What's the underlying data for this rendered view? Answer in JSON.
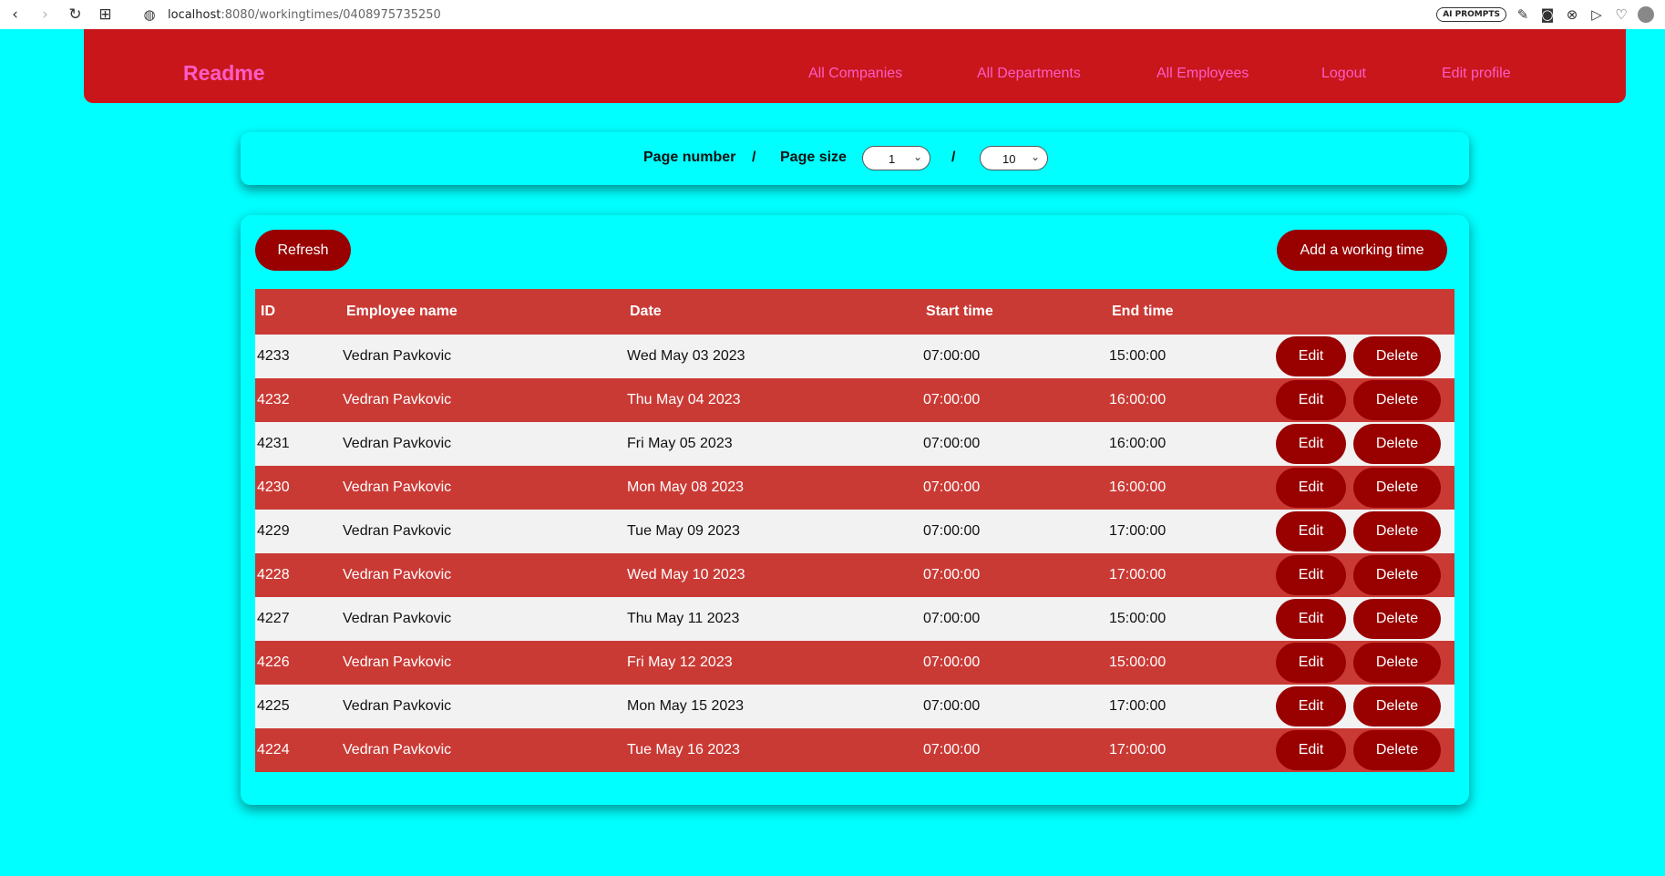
{
  "browser": {
    "url_host": "localhost",
    "url_rest": ":8080/workingtimes/0408975735250",
    "ai_prompts_label": "AI PROMPTS"
  },
  "header": {
    "brand": "Readme",
    "nav": [
      "All Companies",
      "All Departments",
      "All Employees",
      "Logout",
      "Edit profile"
    ]
  },
  "pagination": {
    "page_number_label": "Page number",
    "separator": "/",
    "page_size_label": "Page size",
    "page_number_value": "1",
    "page_size_value": "10"
  },
  "toolbar": {
    "refresh_label": "Refresh",
    "add_label": "Add a working time"
  },
  "table": {
    "columns": [
      "ID",
      "Employee name",
      "Date",
      "Start time",
      "End time"
    ],
    "edit_label": "Edit",
    "delete_label": "Delete",
    "rows": [
      {
        "id": "4233",
        "name": "Vedran Pavkovic",
        "date": "Wed May 03 2023",
        "start": "07:00:00",
        "end": "15:00:00"
      },
      {
        "id": "4232",
        "name": "Vedran Pavkovic",
        "date": "Thu May 04 2023",
        "start": "07:00:00",
        "end": "16:00:00"
      },
      {
        "id": "4231",
        "name": "Vedran Pavkovic",
        "date": "Fri May 05 2023",
        "start": "07:00:00",
        "end": "16:00:00"
      },
      {
        "id": "4230",
        "name": "Vedran Pavkovic",
        "date": "Mon May 08 2023",
        "start": "07:00:00",
        "end": "16:00:00"
      },
      {
        "id": "4229",
        "name": "Vedran Pavkovic",
        "date": "Tue May 09 2023",
        "start": "07:00:00",
        "end": "17:00:00"
      },
      {
        "id": "4228",
        "name": "Vedran Pavkovic",
        "date": "Wed May 10 2023",
        "start": "07:00:00",
        "end": "17:00:00"
      },
      {
        "id": "4227",
        "name": "Vedran Pavkovic",
        "date": "Thu May 11 2023",
        "start": "07:00:00",
        "end": "15:00:00"
      },
      {
        "id": "4226",
        "name": "Vedran Pavkovic",
        "date": "Fri May 12 2023",
        "start": "07:00:00",
        "end": "15:00:00"
      },
      {
        "id": "4225",
        "name": "Vedran Pavkovic",
        "date": "Mon May 15 2023",
        "start": "07:00:00",
        "end": "17:00:00"
      },
      {
        "id": "4224",
        "name": "Vedran Pavkovic",
        "date": "Tue May 16 2023",
        "start": "07:00:00",
        "end": "17:00:00"
      }
    ]
  },
  "colors": {
    "page_bg": "#00ffff",
    "header_bg": "#c8161a",
    "link": "#ff5cc7",
    "button": "#990000",
    "row_alt": "#ca3a35",
    "row_plain": "#f2f2f2"
  }
}
